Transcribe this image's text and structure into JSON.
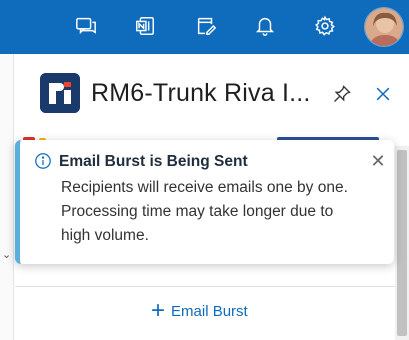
{
  "topbar": {
    "icons": [
      "chat-icon",
      "onenote-icon",
      "edit-icon",
      "bell-icon",
      "gear-icon"
    ]
  },
  "pane": {
    "title": "RM6-Trunk Riva I...",
    "pin_icon": "pin-icon",
    "close_icon": "close-icon"
  },
  "toast": {
    "title": "Email Burst is Being Sent",
    "body": "Recipients will receive emails one by one. Processing time may take longer due to high volume.",
    "close_glyph": "✕"
  },
  "content": {
    "obscured_label": "Email Burst",
    "add_label": "Email Burst",
    "add_glyph": "+"
  },
  "colors": {
    "topbar": "#0f6cbd",
    "accent": "#0f6cbd",
    "toast_accent": "#5aafdf"
  }
}
